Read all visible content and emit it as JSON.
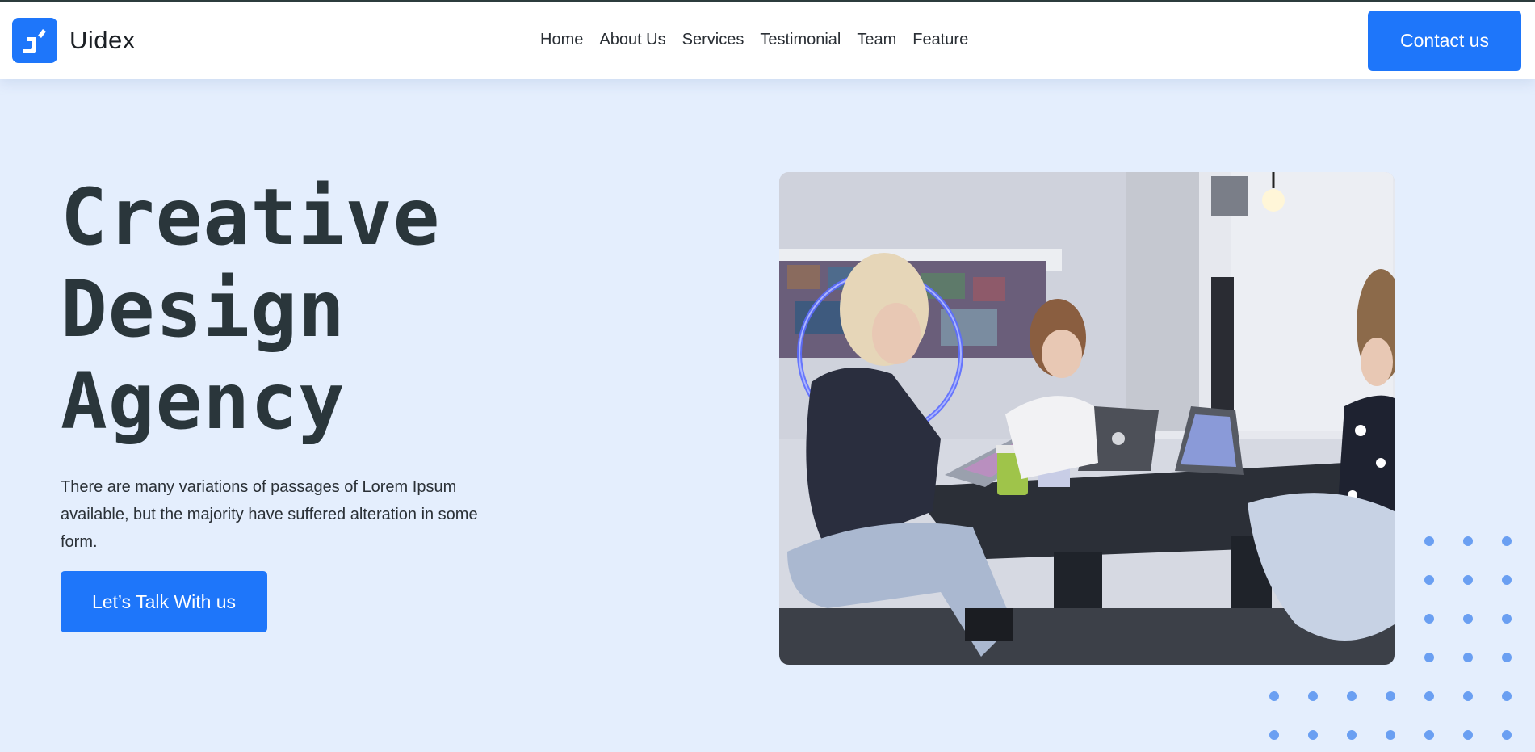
{
  "brand": {
    "name": "Uidex",
    "logo_icon": "uidex-logo-icon",
    "color": "#1e76fa"
  },
  "nav": {
    "items": [
      {
        "label": "Home"
      },
      {
        "label": "About Us"
      },
      {
        "label": "Services"
      },
      {
        "label": "Testimonial"
      },
      {
        "label": "Team"
      },
      {
        "label": "Feature"
      }
    ]
  },
  "header": {
    "contact_label": "Contact us"
  },
  "hero": {
    "title_lines": [
      "Creative",
      "Design",
      "Agency"
    ],
    "description": "There are many variations of passages of Lorem Ipsum available, but the majority have suffered alteration in some form.",
    "cta_label": "Let’s Talk With us",
    "image_icon": "team-meeting-photo"
  },
  "colors": {
    "accent": "#1e76fa",
    "background": "#e4eefd",
    "heading": "#2a363b",
    "dots": "#6a9ff2"
  }
}
